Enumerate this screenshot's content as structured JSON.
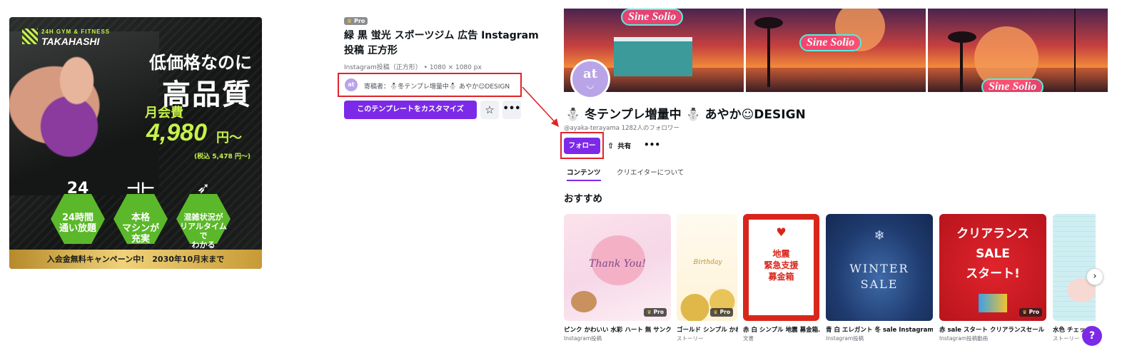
{
  "ad": {
    "brand_sub": "24H GYM & FITNESS",
    "brand": "TAKAHASHI",
    "headline_1": "低価格なのに",
    "headline_2": "高品質",
    "price_label": "月会費",
    "price": "4,980",
    "price_unit": "円〜",
    "price_tax": "(税込 5,478 円〜)",
    "badges": [
      {
        "icon": "24-hours-icon",
        "icon_text": "24",
        "text": "24時間\n通い放題"
      },
      {
        "icon": "dumbbell-icon",
        "icon_text": "⊣⊢",
        "text": "本格\nマシンが\n充実"
      },
      {
        "icon": "running-icon",
        "icon_text": "➶",
        "text": "混雑状況が\nリアルタイムで\nわかる"
      }
    ],
    "footer": "入会金無料キャンペーン中!　2030年10月末まで"
  },
  "template": {
    "pro_label": "Pro",
    "title": "緑 黒 蛍光 スポーツジム 広告 Instagram 投稿 正方形",
    "meta": "Instagram投稿（正方形） • 1080 × 1080 px",
    "contributor_avatar": "at",
    "contributor": "寄稿者：⛄冬テンプレ増量中⛄ あやか☺DESIGN",
    "customize_label": "このテンプレートをカスタマイズ",
    "star_icon": "☆",
    "more_icon": "•••"
  },
  "creator": {
    "banner_sign": "Sine Solio",
    "avatar_top": "at",
    "avatar_bottom": "◡",
    "name": "⛄ 冬テンプレ増量中 ⛄ あやか☺DESIGN",
    "handle_followers": "@ayaka-terayama  1282人のフォロワー",
    "follow_label": "フォロー",
    "share_icon": "⇧",
    "share_label": "共有",
    "more_icon": "•••",
    "tabs": [
      "コンテンツ",
      "クリエイターについて"
    ],
    "section_title": "おすすめ",
    "pro_label": "Pro",
    "cards": [
      {
        "title": "ピンク かわいい 水彩 ハート 無 サンク…",
        "sub": "Instagram投稿",
        "art": "Thank You!",
        "pro": true
      },
      {
        "title": "ゴールド シンプル かわいい…",
        "sub": "ストーリー",
        "art": "Ｂirthday",
        "pro": true
      },
      {
        "title": "赤 白 シンプル 地震 募金箱…",
        "sub": "文書",
        "art": "地震\n緊急支援\n募金箱",
        "pro": false
      },
      {
        "title": "青 白 エレガント 冬 sale Instagram 投…",
        "sub": "Instagram投稿",
        "art": "WINTER\nSALE",
        "pro": false
      },
      {
        "title": "赤 sale スタート クリアランスセール I…",
        "sub": "Instagram投稿動画",
        "art": "クリアランス\nSALE\nスタート!",
        "pro": true
      },
      {
        "title": "水色 チェック…",
        "sub": "ストーリー",
        "art": "",
        "pro": false
      }
    ],
    "next_icon": "›",
    "help_label": "?"
  },
  "colors": {
    "accent": "#7d2ae8",
    "highlight": "#e0232a",
    "neon_green": "#c6f24a"
  }
}
